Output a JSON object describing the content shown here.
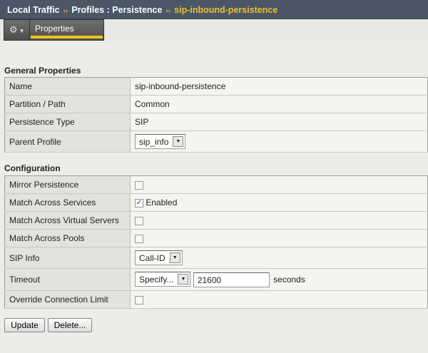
{
  "breadcrumb": [
    "Local Traffic",
    "Profiles : Persistence",
    "sip-inbound-persistence"
  ],
  "separator": "››",
  "tabs": {
    "properties": "Properties"
  },
  "general": {
    "title": "General Properties",
    "rows": [
      {
        "label": "Name",
        "value": "sip-inbound-persistence"
      },
      {
        "label": "Partition / Path",
        "value": "Common"
      },
      {
        "label": "Persistence Type",
        "value": "SIP"
      },
      {
        "label": "Parent Profile",
        "value": "sip_info"
      }
    ]
  },
  "config": {
    "title": "Configuration",
    "rows": [
      {
        "label": "Mirror Persistence",
        "checked": false
      },
      {
        "label": "Match Across Services",
        "checked": true,
        "text": "Enabled"
      },
      {
        "label": "Match Across Virtual Servers",
        "checked": false
      },
      {
        "label": "Match Across Pools",
        "checked": false
      },
      {
        "label": "SIP Info",
        "value": "Call-ID"
      },
      {
        "label": "Timeout",
        "mode": "Specify...",
        "value": "21600",
        "unit": "seconds"
      },
      {
        "label": "Override Connection Limit",
        "checked": false
      }
    ]
  },
  "buttons": {
    "update": "Update",
    "delete": "Delete..."
  }
}
